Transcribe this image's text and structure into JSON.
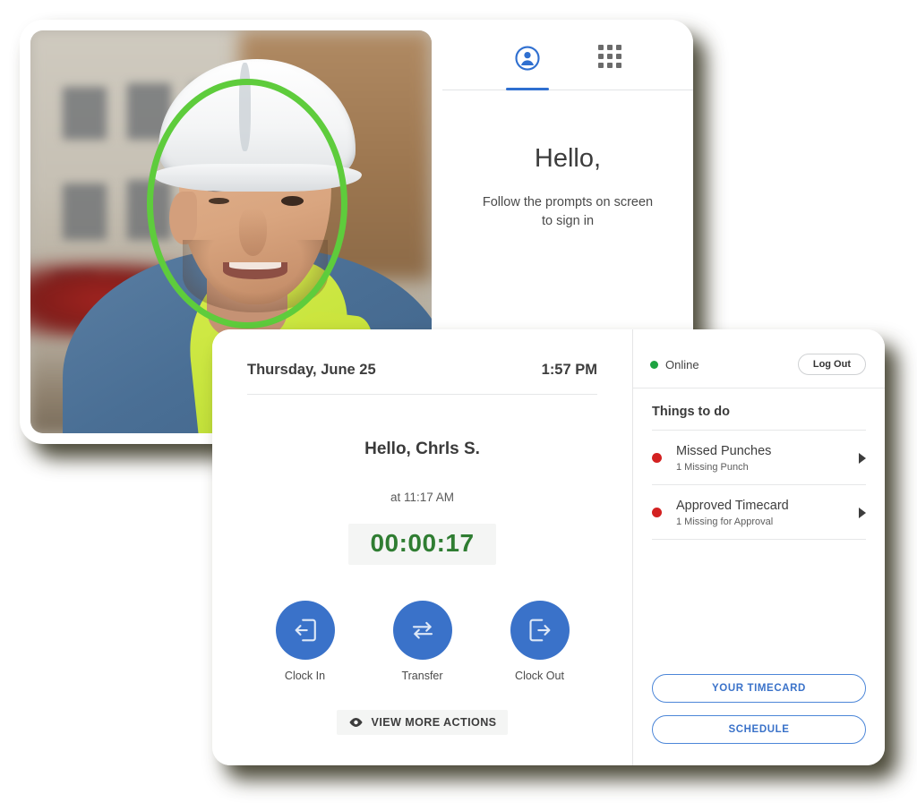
{
  "kiosk": {
    "tabs": [
      {
        "name": "person-tab",
        "icon": "person-icon",
        "active": true
      },
      {
        "name": "keypad-tab",
        "icon": "grid-icon",
        "active": false
      }
    ],
    "greeting": "Hello,",
    "instruction_line1": "Follow the prompts on screen",
    "instruction_line2": "to sign in",
    "face_ring_color": "#5ECC3C",
    "accent_color": "#2f6fd0",
    "photo_alt": "construction worker with white hard hat and yellow hi-vis vest"
  },
  "dashboard": {
    "date": "Thursday, June 25",
    "time": "1:57 PM",
    "greeting": "Hello, Chrls S.",
    "since_label": "at 11:17 AM",
    "timer": "00:00:17",
    "timer_color": "#2f7d32",
    "actions": [
      {
        "label": "Clock In",
        "icon": "clock-in-icon"
      },
      {
        "label": "Transfer",
        "icon": "transfer-icon"
      },
      {
        "label": "Clock Out",
        "icon": "clock-out-icon"
      }
    ],
    "view_more_label": "VIEW MORE ACTIONS",
    "view_more_icon": "eye-icon",
    "action_color": "#3a72c9"
  },
  "right_panel": {
    "status": "Online",
    "status_color": "#1ea341",
    "logout_label": "Log Out",
    "todo_title": "Things to do",
    "todos": [
      {
        "label": "Missed Punches",
        "sub": "1 Missing Punch",
        "dot_color": "#d32121"
      },
      {
        "label": "Approved Timecard",
        "sub": "1 Missing for Approval",
        "dot_color": "#d32121"
      }
    ],
    "buttons": [
      {
        "label": "YOUR TIMECARD"
      },
      {
        "label": "SCHEDULE"
      }
    ],
    "button_color": "#3a72c9"
  }
}
